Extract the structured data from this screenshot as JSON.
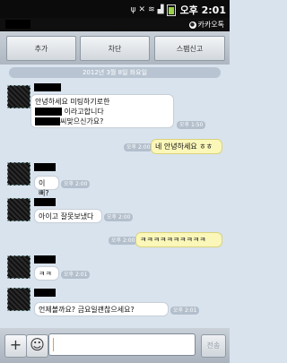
{
  "status_bar": {
    "icons": [
      "usb-icon",
      "mute-icon",
      "wifi-icon",
      "signal-icon",
      "battery-icon"
    ],
    "time": "오후 2:01"
  },
  "title_bar": {
    "app_label": "카카오톡"
  },
  "actions": [
    {
      "label": "추가"
    },
    {
      "label": "차단"
    },
    {
      "label": "스팸신고"
    }
  ],
  "date_divider": "2012년 3월 8일 화요일",
  "messages": [
    {
      "dir": "in",
      "lines": [
        "안녕하세요 미팅하기로한",
        "이라고합니다",
        "씨맞으신가요?"
      ],
      "time": "오후 1:50"
    },
    {
      "dir": "out",
      "text": "네 안녕하세요 ㅎㅎ",
      "time": "오후 2:00"
    },
    {
      "dir": "in",
      "text": "이뻐?",
      "time": "오후 2:00"
    },
    {
      "dir": "in",
      "text": "아이고 잘못보냈다",
      "time": "오후 2:00"
    },
    {
      "dir": "out",
      "text": "ㅋㅋㅋㅋㅋㅋㅋㅋㅋㅋ",
      "time": "오후 2:00"
    },
    {
      "dir": "in",
      "text": "ㅋㅋ",
      "time": "오후 2:01"
    },
    {
      "dir": "in",
      "text": "언제볼까요? 금요일괜찮으세요?",
      "time": "오후 2:01"
    }
  ],
  "input_bar": {
    "plus": "+",
    "emoticon": "☺",
    "send_label": "전송",
    "input_value": ""
  },
  "colors": {
    "chat_bg": "#d9e3ee",
    "bubble_out": "#fbf7b9",
    "bubble_in": "#ffffff"
  }
}
